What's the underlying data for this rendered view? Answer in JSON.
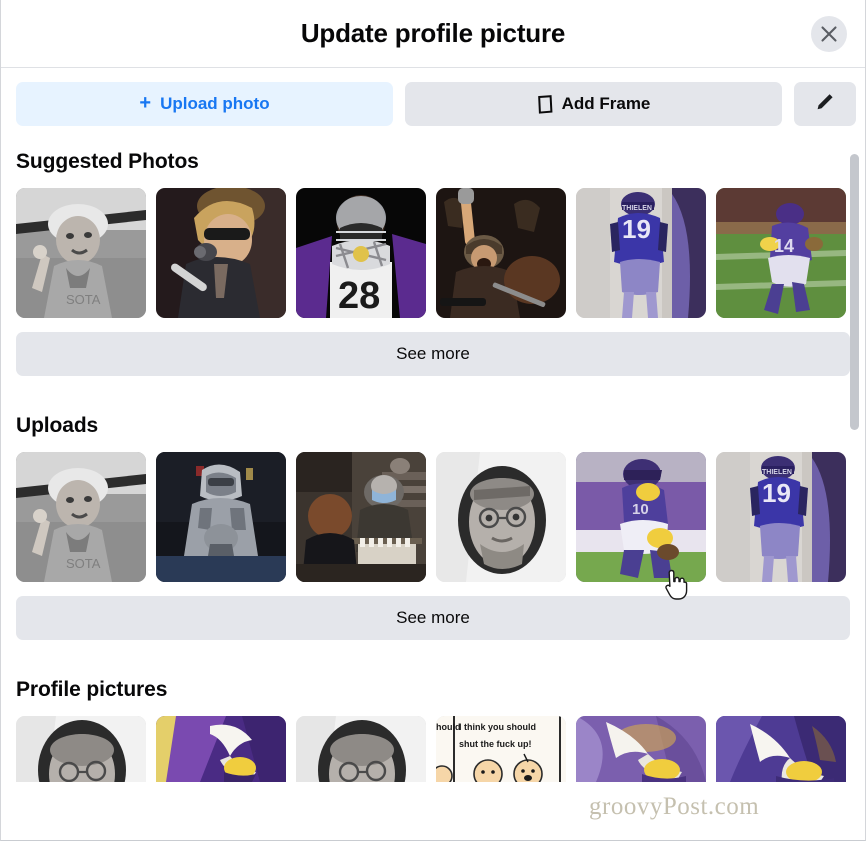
{
  "dialog": {
    "title": "Update profile picture",
    "close_icon": "close-icon"
  },
  "actions": {
    "upload_label": "Upload photo",
    "upload_plus": "+",
    "upload_icon": "plus-icon",
    "frame_label": "Add Frame",
    "frame_icon": "frame-icon",
    "edit_icon": "pencil-icon"
  },
  "sections": [
    {
      "id": "suggested-photos",
      "title": "Suggested Photos",
      "see_more_label": "See more",
      "photos": [
        {
          "alt": "man-in-beanie-black-and-white",
          "kind": "bw-portrait"
        },
        {
          "alt": "blond-singer-with-sunglasses-at-microphone",
          "kind": "singer"
        },
        {
          "alt": "football-player-number-28-celebrating",
          "kind": "player28"
        },
        {
          "alt": "drummer-with-raised-arm-on-stage",
          "kind": "drummer"
        },
        {
          "alt": "thielen-jersey-number-19-from-behind",
          "kind": "thielen19"
        },
        {
          "alt": "player-number-14-running-with-ball",
          "kind": "player14"
        }
      ]
    },
    {
      "id": "uploads",
      "title": "Uploads",
      "see_more_label": "See more",
      "photos": [
        {
          "alt": "man-in-beanie-black-and-white",
          "kind": "bw-portrait"
        },
        {
          "alt": "mandalorian-in-armor",
          "kind": "mandalorian"
        },
        {
          "alt": "chess-player-in-mask-at-tournament",
          "kind": "chess"
        },
        {
          "alt": "bearded-man-with-glasses-in-hoodie",
          "kind": "hoodie-selfie"
        },
        {
          "alt": "kneeling-football-player-in-purple",
          "kind": "kneeling-player"
        },
        {
          "alt": "thielen-jersey-number-19-from-behind",
          "kind": "thielen19"
        }
      ]
    },
    {
      "id": "profile-pictures",
      "title": "Profile pictures",
      "photos": [
        {
          "alt": "bearded-man-with-glasses-in-hoodie",
          "kind": "hoodie-selfie"
        },
        {
          "alt": "vikings-horn-logo-purple-gold",
          "kind": "vikings-logo-a"
        },
        {
          "alt": "bearded-man-with-glasses-in-hoodie",
          "kind": "hoodie-selfie"
        },
        {
          "alt": "comic-i-think-you-should-shut-the-fuck-up",
          "kind": "comic",
          "comic_line1": "I think you should",
          "comic_line2": "shut the fuck up!",
          "comic_edge": "hould"
        },
        {
          "alt": "vikings-horn-logo-purple-swirl",
          "kind": "vikings-logo-b"
        },
        {
          "alt": "vikings-horn-logo-on-purple",
          "kind": "vikings-logo-c"
        }
      ]
    }
  ],
  "watermark": "groovyPost.com",
  "scrollbar": {
    "name": "vertical-scrollbar"
  },
  "cursor": {
    "name": "pointer-hand-cursor"
  },
  "colors": {
    "accent_blue": "#1877f2",
    "accent_blue_bg": "#e7f3ff",
    "grey_button": "#e4e6eb",
    "divider": "#dfe1e5",
    "scroll_thumb": "#c4c7cd"
  }
}
